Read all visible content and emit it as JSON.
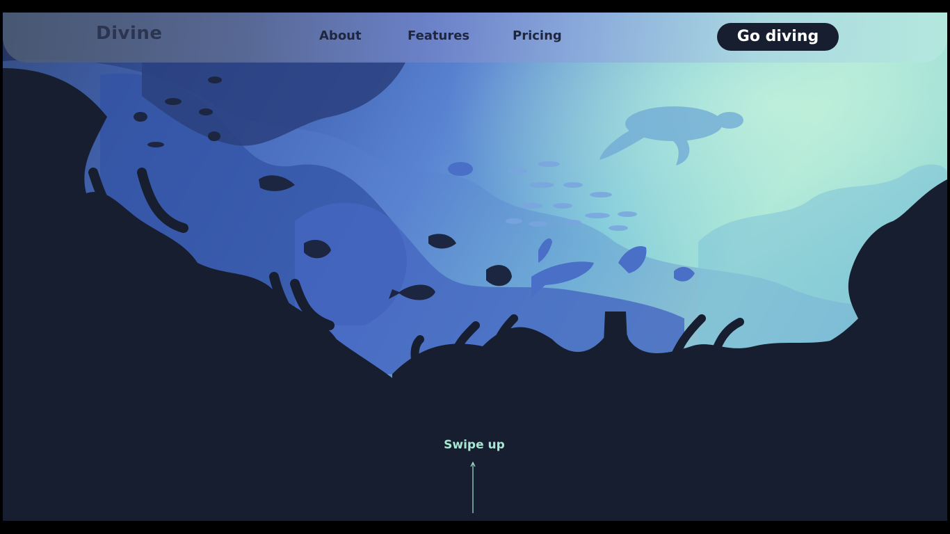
{
  "brand": {
    "logo_text": "Divine"
  },
  "nav": {
    "links": [
      {
        "label": "About"
      },
      {
        "label": "Features"
      },
      {
        "label": "Pricing"
      }
    ],
    "cta_label": "Go diving"
  },
  "hero": {
    "swipe_label": "Swipe up",
    "arrow_icon": "arrow-up-icon"
  },
  "colors": {
    "dark": "#161e2f",
    "accent_text": "#a7e6d2",
    "cta_text": "#ffffff",
    "light_water": "#a9e6d6",
    "deep_water": "#3d5db6"
  }
}
